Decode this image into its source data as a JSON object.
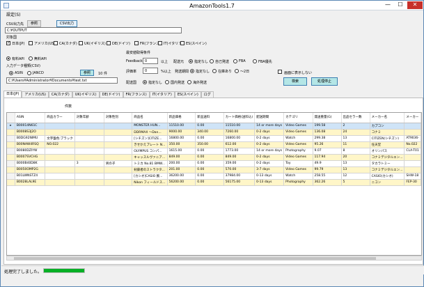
{
  "window": {
    "title": "AmazonTools1.7",
    "min": "—",
    "max": "☐",
    "close": "✕"
  },
  "menu": {
    "settings": "設定(S)"
  },
  "csv": {
    "label": "CSV出力先",
    "browse": "参照",
    "output": "CSV出力",
    "path": "C:¥OUTPUT"
  },
  "target_countries": {
    "label": "対象国",
    "items": [
      {
        "label": "日本(JP)",
        "checked": true
      },
      {
        "label": "アメリカ(US)",
        "checked": false
      },
      {
        "label": "CA(カナダ)",
        "checked": false
      },
      {
        "label": "UK(イギリス)",
        "checked": false
      },
      {
        "label": "DE(ドイツ)",
        "checked": false
      },
      {
        "label": "FR(フランス)",
        "checked": false
      },
      {
        "label": "IT(イタリア)",
        "checked": false
      },
      {
        "label": "ES(スペイン)",
        "checked": false
      }
    ]
  },
  "api": {
    "paid": "有料API",
    "free": "無料API"
  },
  "input": {
    "label": "入力データ種類(CSV)",
    "asin": "ASIN",
    "jancd": "JANCD",
    "browse": "参照",
    "count": "10 件",
    "path": "C:¥Users¥Administrator¥Documents¥test.txt"
  },
  "shipping": {
    "section_label": "最安値取得条件",
    "feedback_label": "Feedback",
    "feedback_value": "0",
    "feedback_unit": "以上",
    "origin_label": "配送元",
    "origin_options": [
      "指定なし",
      "自己発送",
      "FBA",
      "FBA優先"
    ],
    "rating_label": "評価率",
    "rating_value": "0",
    "rating_unit": "%以上",
    "period_label": "発送期間",
    "period_options": [
      "指定なし",
      "在庫あり",
      "〜2日"
    ],
    "dest_label": "配送国",
    "dest_options": [
      "指定なし",
      "国内発送",
      "海外発送"
    ],
    "show_screen": "画面に表示しない",
    "search": "検索",
    "stop": "処理停止"
  },
  "tabs": [
    "日本(JP)",
    "アメリカ(US)",
    "CA(カナダ)",
    "UK(イギリス)",
    "DE(ドイツ)",
    "FR(フランス)",
    "IT(イタリア)",
    "ES(スペイン)",
    "ログ"
  ],
  "count_label": "件数",
  "grid": {
    "columns": [
      "ASIN",
      "商品カラー",
      "対象年齢",
      "対象性別",
      "商品名",
      "新品価格",
      "新品送料",
      "カート価格(送料込)",
      "配送期間",
      "カテゴリ",
      "発送重量(G)",
      "出品セラー数",
      "メーカー名",
      "メーカー"
    ],
    "rows": [
      [
        "B00014N61C",
        "",
        "",
        "",
        "MONSTER HUN...",
        "11510.00",
        "0.00",
        "11510.00",
        "14 or more days",
        "Video Games",
        "199.58",
        "2",
        "カプコン",
        ""
      ],
      [
        "B0008S3J2O",
        "",
        "",
        "",
        "DDRMAX 〜Dan...",
        "9000.00",
        "340.00",
        "7260.00",
        "0-2 days",
        "Video Games",
        "136.08",
        "24",
        "コナミ",
        ""
      ],
      [
        "B0DG92NIMU",
        "文字盤色:ブラック",
        "",
        "",
        "[シチズン]CITIZE...",
        "16800.00",
        "0.00",
        "16800.00",
        "0-2 days",
        "Watch",
        "299.38",
        "13",
        "CITIZEN(シチズン)",
        "AT9036-"
      ],
      [
        "B00NAW4RSQ",
        "NO.022",
        "",
        "",
        "きせかえプレート N...",
        "350.00",
        "350.00",
        "612.00",
        "0-2 days",
        "Video Games",
        "95.26",
        "11",
        "任天堂",
        "No.022"
      ],
      [
        "B0080DZIYW",
        "",
        "",
        "",
        "OLYMPUS コンパ...",
        "1615.00",
        "0.00",
        "1773.00",
        "14 or more days",
        "Photography",
        "9.07",
        "8",
        "オリンパス",
        "CLA-T01"
      ],
      [
        "B0007SVCHG",
        "",
        "",
        "",
        "キャッスルヴァニア...",
        "849.00",
        "0.00",
        "849.00",
        "0-2 days",
        "Video Games",
        "117.94",
        "20",
        "コナミデジタルエン...",
        ""
      ],
      [
        "B000B40D8K",
        "",
        "3",
        "男の子",
        "トミカ No.81 BMW...",
        "200.00",
        "0.00",
        "359.00",
        "0-2 days",
        "Toy",
        "49.9",
        "13",
        "タカラトミー",
        ""
      ],
      [
        "B0050OMP2G",
        "",
        "",
        "",
        "剣豪者のストラクタ...",
        "201.00",
        "0.00",
        "570.00",
        "3-7 days",
        "Video Games",
        "99.79",
        "13",
        "コナミデジタルエン...",
        ""
      ],
      [
        "B01LWNSTZ4",
        "",
        "",
        "",
        "[カシオ]CASIO 腕...",
        "36200.00",
        "0.00",
        "37984.00",
        "0-13 days",
        "Watch",
        "258.55",
        "12",
        "CASIO(カシオ)",
        "SHW-18"
      ],
      [
        "B0028LAL9E",
        "",
        "",
        "",
        "Nikon フィールドス...",
        "56200.00",
        "0.00",
        "56175.00",
        "0-13 days",
        "Photography",
        "362.26",
        "5",
        "ニコン",
        "FEP-30"
      ]
    ]
  },
  "status": {
    "text": "処理完了しました。",
    "progress_pct": 100
  }
}
